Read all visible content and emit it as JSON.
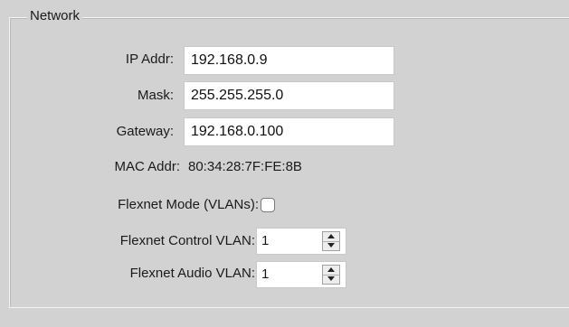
{
  "network": {
    "title": "Network",
    "ip_label": "IP Addr:",
    "ip_value": "192.168.0.9",
    "mask_label": "Mask:",
    "mask_value": "255.255.255.0",
    "gateway_label": "Gateway:",
    "gateway_value": "192.168.0.100",
    "mac_label": "MAC Addr:",
    "mac_value": "80:34:28:7F:FE:8B",
    "flexnet_mode_label": "Flexnet Mode (VLANs):",
    "flexnet_mode_checked": false,
    "control_vlan_label": "Flexnet Control VLAN:",
    "control_vlan_value": "1",
    "audio_vlan_label": "Flexnet Audio VLAN:",
    "audio_vlan_value": "1"
  }
}
